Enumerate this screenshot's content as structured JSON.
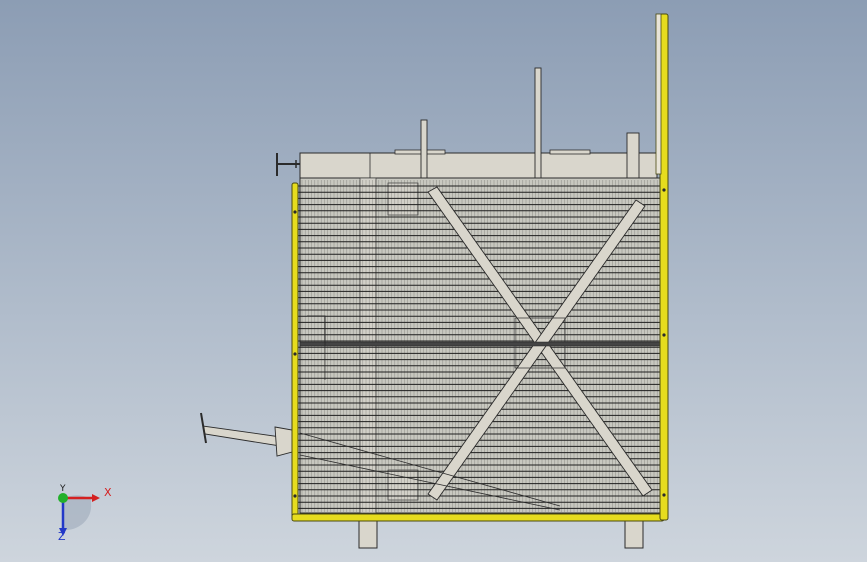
{
  "viewport": {
    "background_top": "#8c9db4",
    "background_bottom": "#ced5dd"
  },
  "model": {
    "frame_color": "#e6dc1e",
    "frame_outline": "#4a4a10",
    "plate_color": "#d9d6cc",
    "edge_color": "#2b2b2b"
  },
  "triad": {
    "x_label": "X",
    "y_label": "Y",
    "z_label": "Z",
    "x_color": "#d42020",
    "y_color": "#22b02a",
    "z_color": "#2238c8"
  }
}
